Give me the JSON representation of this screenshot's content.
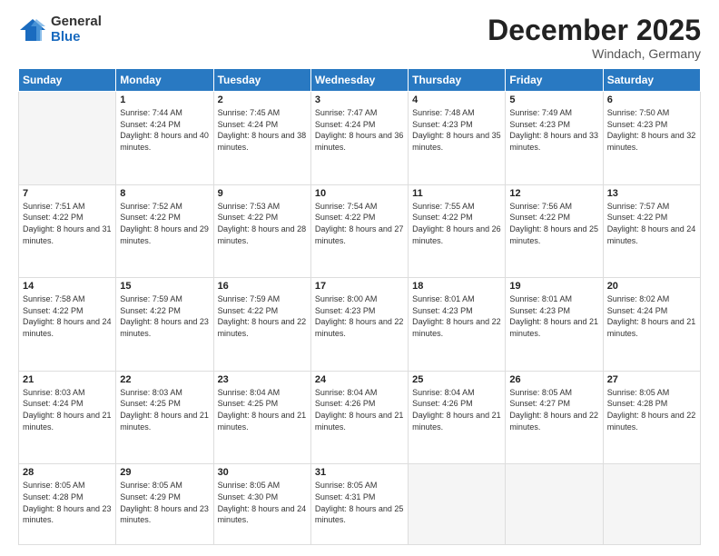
{
  "header": {
    "logo_general": "General",
    "logo_blue": "Blue",
    "month_title": "December 2025",
    "location": "Windach, Germany"
  },
  "weekdays": [
    "Sunday",
    "Monday",
    "Tuesday",
    "Wednesday",
    "Thursday",
    "Friday",
    "Saturday"
  ],
  "weeks": [
    [
      {
        "day": "",
        "empty": true
      },
      {
        "day": "1",
        "sunrise": "7:44 AM",
        "sunset": "4:24 PM",
        "daylight": "8 hours and 40 minutes."
      },
      {
        "day": "2",
        "sunrise": "7:45 AM",
        "sunset": "4:24 PM",
        "daylight": "8 hours and 38 minutes."
      },
      {
        "day": "3",
        "sunrise": "7:47 AM",
        "sunset": "4:24 PM",
        "daylight": "8 hours and 36 minutes."
      },
      {
        "day": "4",
        "sunrise": "7:48 AM",
        "sunset": "4:23 PM",
        "daylight": "8 hours and 35 minutes."
      },
      {
        "day": "5",
        "sunrise": "7:49 AM",
        "sunset": "4:23 PM",
        "daylight": "8 hours and 33 minutes."
      },
      {
        "day": "6",
        "sunrise": "7:50 AM",
        "sunset": "4:23 PM",
        "daylight": "8 hours and 32 minutes."
      }
    ],
    [
      {
        "day": "7",
        "sunrise": "7:51 AM",
        "sunset": "4:22 PM",
        "daylight": "8 hours and 31 minutes."
      },
      {
        "day": "8",
        "sunrise": "7:52 AM",
        "sunset": "4:22 PM",
        "daylight": "8 hours and 29 minutes."
      },
      {
        "day": "9",
        "sunrise": "7:53 AM",
        "sunset": "4:22 PM",
        "daylight": "8 hours and 28 minutes."
      },
      {
        "day": "10",
        "sunrise": "7:54 AM",
        "sunset": "4:22 PM",
        "daylight": "8 hours and 27 minutes."
      },
      {
        "day": "11",
        "sunrise": "7:55 AM",
        "sunset": "4:22 PM",
        "daylight": "8 hours and 26 minutes."
      },
      {
        "day": "12",
        "sunrise": "7:56 AM",
        "sunset": "4:22 PM",
        "daylight": "8 hours and 25 minutes."
      },
      {
        "day": "13",
        "sunrise": "7:57 AM",
        "sunset": "4:22 PM",
        "daylight": "8 hours and 24 minutes."
      }
    ],
    [
      {
        "day": "14",
        "sunrise": "7:58 AM",
        "sunset": "4:22 PM",
        "daylight": "8 hours and 24 minutes."
      },
      {
        "day": "15",
        "sunrise": "7:59 AM",
        "sunset": "4:22 PM",
        "daylight": "8 hours and 23 minutes."
      },
      {
        "day": "16",
        "sunrise": "7:59 AM",
        "sunset": "4:22 PM",
        "daylight": "8 hours and 22 minutes."
      },
      {
        "day": "17",
        "sunrise": "8:00 AM",
        "sunset": "4:23 PM",
        "daylight": "8 hours and 22 minutes."
      },
      {
        "day": "18",
        "sunrise": "8:01 AM",
        "sunset": "4:23 PM",
        "daylight": "8 hours and 22 minutes."
      },
      {
        "day": "19",
        "sunrise": "8:01 AM",
        "sunset": "4:23 PM",
        "daylight": "8 hours and 21 minutes."
      },
      {
        "day": "20",
        "sunrise": "8:02 AM",
        "sunset": "4:24 PM",
        "daylight": "8 hours and 21 minutes."
      }
    ],
    [
      {
        "day": "21",
        "sunrise": "8:03 AM",
        "sunset": "4:24 PM",
        "daylight": "8 hours and 21 minutes."
      },
      {
        "day": "22",
        "sunrise": "8:03 AM",
        "sunset": "4:25 PM",
        "daylight": "8 hours and 21 minutes."
      },
      {
        "day": "23",
        "sunrise": "8:04 AM",
        "sunset": "4:25 PM",
        "daylight": "8 hours and 21 minutes."
      },
      {
        "day": "24",
        "sunrise": "8:04 AM",
        "sunset": "4:26 PM",
        "daylight": "8 hours and 21 minutes."
      },
      {
        "day": "25",
        "sunrise": "8:04 AM",
        "sunset": "4:26 PM",
        "daylight": "8 hours and 21 minutes."
      },
      {
        "day": "26",
        "sunrise": "8:05 AM",
        "sunset": "4:27 PM",
        "daylight": "8 hours and 22 minutes."
      },
      {
        "day": "27",
        "sunrise": "8:05 AM",
        "sunset": "4:28 PM",
        "daylight": "8 hours and 22 minutes."
      }
    ],
    [
      {
        "day": "28",
        "sunrise": "8:05 AM",
        "sunset": "4:28 PM",
        "daylight": "8 hours and 23 minutes."
      },
      {
        "day": "29",
        "sunrise": "8:05 AM",
        "sunset": "4:29 PM",
        "daylight": "8 hours and 23 minutes."
      },
      {
        "day": "30",
        "sunrise": "8:05 AM",
        "sunset": "4:30 PM",
        "daylight": "8 hours and 24 minutes."
      },
      {
        "day": "31",
        "sunrise": "8:05 AM",
        "sunset": "4:31 PM",
        "daylight": "8 hours and 25 minutes."
      },
      {
        "day": "",
        "empty": true
      },
      {
        "day": "",
        "empty": true
      },
      {
        "day": "",
        "empty": true
      }
    ]
  ]
}
